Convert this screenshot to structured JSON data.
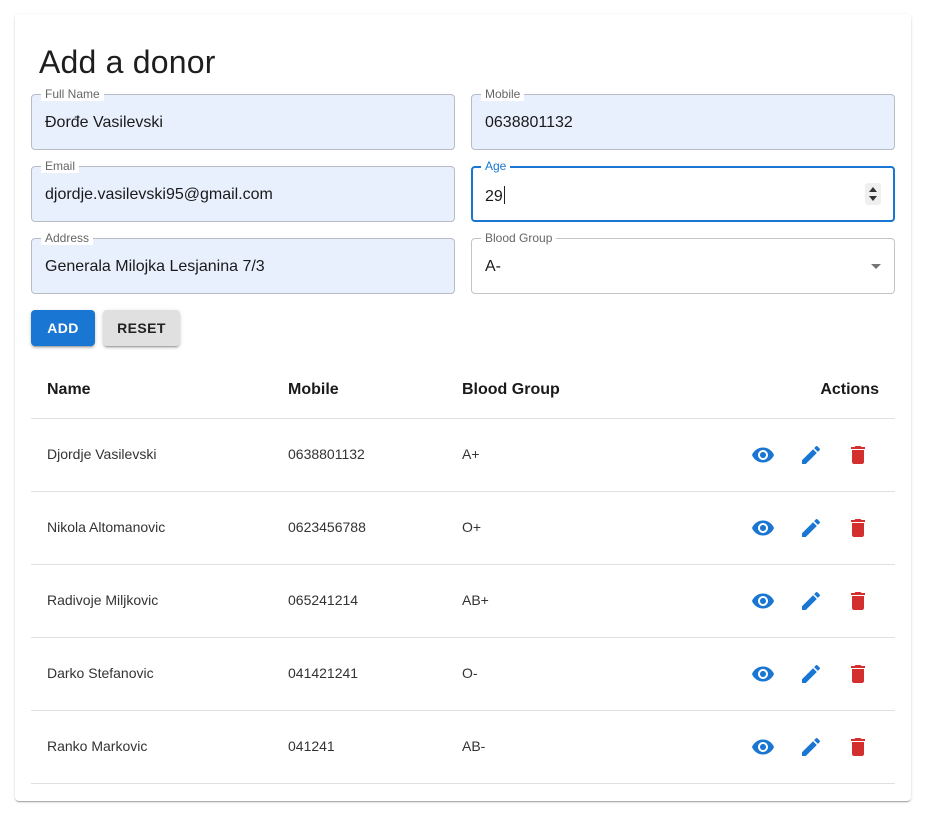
{
  "page": {
    "title": "Add a donor"
  },
  "form": {
    "full_name": {
      "label": "Full Name",
      "value": "Đorđe Vasilevski"
    },
    "mobile": {
      "label": "Mobile",
      "value": "0638801132"
    },
    "email": {
      "label": "Email",
      "value": "djordje.vasilevski95@gmail.com"
    },
    "age": {
      "label": "Age",
      "value": "29"
    },
    "address": {
      "label": "Address",
      "value": "Generala Milojka Lesjanina 7/3"
    },
    "blood_group": {
      "label": "Blood Group",
      "value": "A-"
    },
    "add_label": "ADD",
    "reset_label": "RESET"
  },
  "table": {
    "headers": {
      "name": "Name",
      "mobile": "Mobile",
      "blood_group": "Blood Group",
      "actions": "Actions"
    },
    "rows": [
      {
        "name": "Djordje Vasilevski",
        "mobile": "0638801132",
        "blood_group": "A+"
      },
      {
        "name": "Nikola Altomanovic",
        "mobile": "0623456788",
        "blood_group": "O+"
      },
      {
        "name": "Radivoje Miljkovic",
        "mobile": "065241214",
        "blood_group": "AB+"
      },
      {
        "name": "Darko Stefanovic",
        "mobile": "041421241",
        "blood_group": "O-"
      },
      {
        "name": "Ranko Markovic",
        "mobile": "041241",
        "blood_group": "AB-"
      }
    ],
    "action_icons": [
      "eye-icon",
      "pencil-icon",
      "trash-icon"
    ]
  },
  "colors": {
    "primary": "#1976d2",
    "danger": "#d32f2f",
    "autofill_bg": "#e8f0fe",
    "reset_bg": "#e0e0e0"
  }
}
